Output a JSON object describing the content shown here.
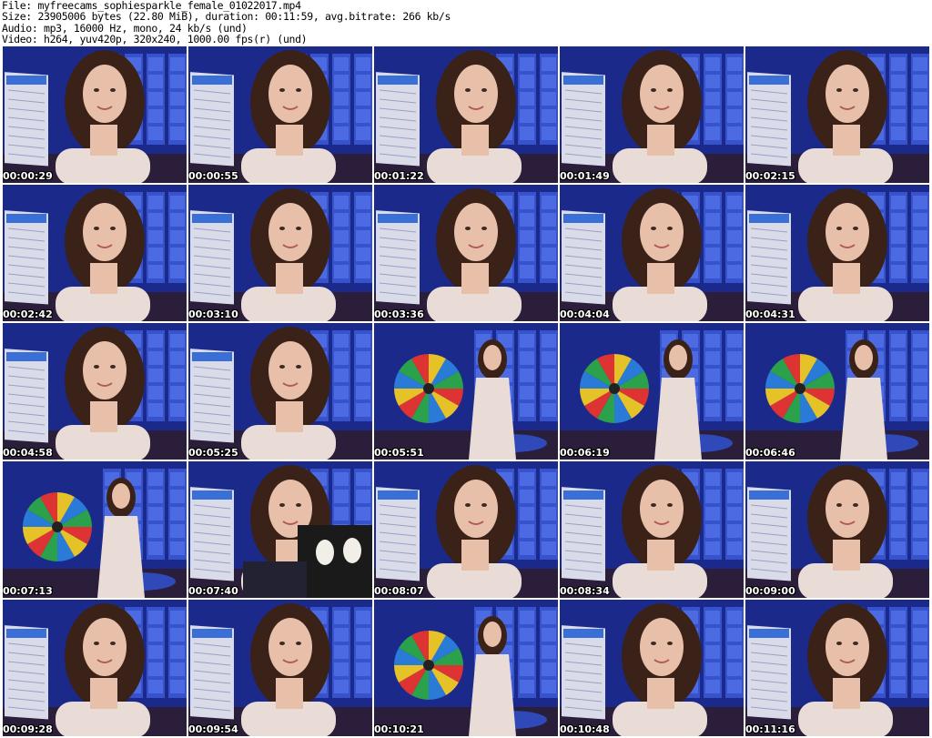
{
  "header": {
    "file_line": "File: myfreecams_sophiesparkle_female_01022017.mp4",
    "size_line": "Size: 23905006 bytes (22.80 MiB), duration: 00:11:59, avg.bitrate: 266 kb/s",
    "audio_line": "Audio: mp3, 16000 Hz, mono, 24 kb/s (und)",
    "video_line": "Video: h264, yuv420p, 320x240, 1000.00 fps(r) (und)"
  },
  "thumbnails": [
    {
      "timestamp": "00:00:29",
      "scene": "board"
    },
    {
      "timestamp": "00:00:55",
      "scene": "board"
    },
    {
      "timestamp": "00:01:22",
      "scene": "board"
    },
    {
      "timestamp": "00:01:49",
      "scene": "board"
    },
    {
      "timestamp": "00:02:15",
      "scene": "board"
    },
    {
      "timestamp": "00:02:42",
      "scene": "board"
    },
    {
      "timestamp": "00:03:10",
      "scene": "board"
    },
    {
      "timestamp": "00:03:36",
      "scene": "board"
    },
    {
      "timestamp": "00:04:04",
      "scene": "board"
    },
    {
      "timestamp": "00:04:31",
      "scene": "board"
    },
    {
      "timestamp": "00:04:58",
      "scene": "board"
    },
    {
      "timestamp": "00:05:25",
      "scene": "board"
    },
    {
      "timestamp": "00:05:51",
      "scene": "wheel"
    },
    {
      "timestamp": "00:06:19",
      "scene": "wheel"
    },
    {
      "timestamp": "00:06:46",
      "scene": "wheel"
    },
    {
      "timestamp": "00:07:13",
      "scene": "wheel"
    },
    {
      "timestamp": "00:07:40",
      "scene": "dark"
    },
    {
      "timestamp": "00:08:07",
      "scene": "board"
    },
    {
      "timestamp": "00:08:34",
      "scene": "board"
    },
    {
      "timestamp": "00:09:00",
      "scene": "board"
    },
    {
      "timestamp": "00:09:28",
      "scene": "board"
    },
    {
      "timestamp": "00:09:54",
      "scene": "board"
    },
    {
      "timestamp": "00:10:21",
      "scene": "wheel"
    },
    {
      "timestamp": "00:10:48",
      "scene": "board"
    },
    {
      "timestamp": "00:11:16",
      "scene": "board"
    }
  ],
  "colors": {
    "background": "#ffffff",
    "header_text": "#000000",
    "timestamp_text": "#ffffff",
    "backdrop_blue": "#1b2a8a",
    "panel_blue": "#3b5bd8",
    "hair_brown": "#3a2218",
    "skin": "#e8bfa8",
    "dress": "#e9dcd7"
  }
}
